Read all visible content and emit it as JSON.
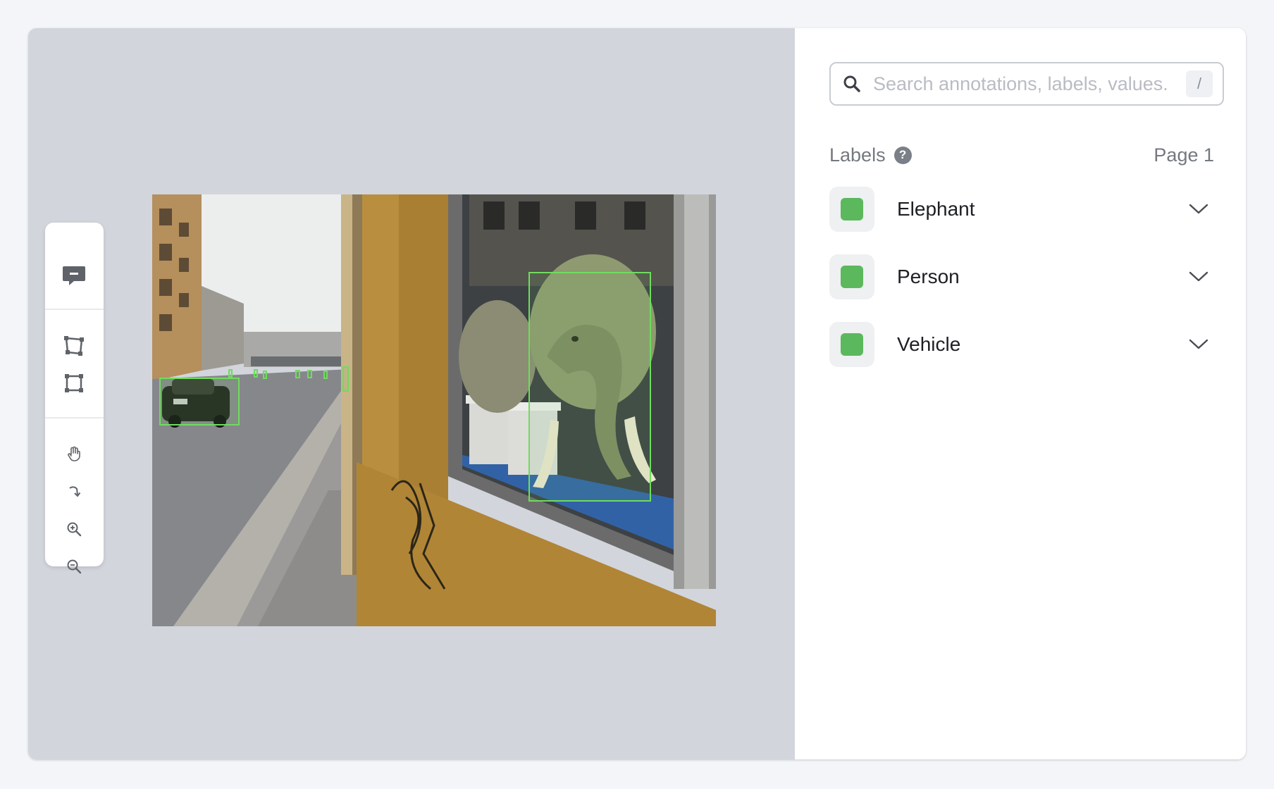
{
  "search": {
    "placeholder": "Search annotations, labels, values.",
    "shortcut": "/"
  },
  "labels": {
    "title": "Labels",
    "help": "?",
    "page": "Page 1",
    "items": [
      {
        "name": "Elephant",
        "color": "#5cb85c"
      },
      {
        "name": "Person",
        "color": "#5cb85c"
      },
      {
        "name": "Vehicle",
        "color": "#5cb85c"
      }
    ]
  },
  "annotation_color": "#6fdc5d",
  "toolbar": {
    "tools": [
      "comment-icon",
      "polygon-icon",
      "rectangle-icon",
      "pan-hand-icon",
      "rotate-icon",
      "zoom-in-icon",
      "zoom-out-icon"
    ]
  }
}
